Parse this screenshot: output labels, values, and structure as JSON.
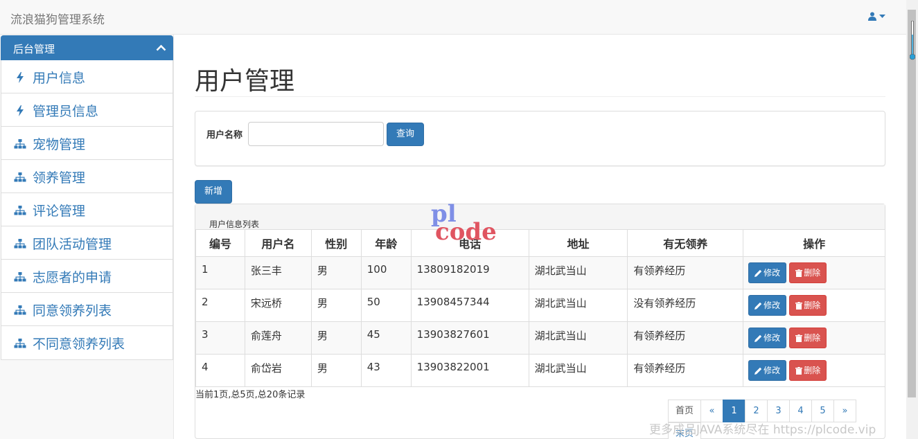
{
  "app": {
    "title": "流浪猫狗管理系统"
  },
  "sidebar": {
    "header": "后台管理",
    "items": [
      {
        "label": "用户信息",
        "icon": "bolt-icon"
      },
      {
        "label": "管理员信息",
        "icon": "bolt-icon"
      },
      {
        "label": "宠物管理",
        "icon": "sitemap-icon"
      },
      {
        "label": "领养管理",
        "icon": "sitemap-icon"
      },
      {
        "label": "评论管理",
        "icon": "sitemap-icon"
      },
      {
        "label": "团队活动管理",
        "icon": "sitemap-icon"
      },
      {
        "label": "志愿者的申请",
        "icon": "sitemap-icon"
      },
      {
        "label": "同意领养列表",
        "icon": "sitemap-icon"
      },
      {
        "label": "不同意领养列表",
        "icon": "sitemap-icon"
      }
    ]
  },
  "main": {
    "page_title": "用户管理",
    "search": {
      "label": "用户名称",
      "value": "",
      "button": "查询"
    },
    "add_button": "新增",
    "table": {
      "caption": "用户信息列表",
      "columns": [
        "编号",
        "用户名",
        "性别",
        "年龄",
        "电话",
        "地址",
        "有无领养",
        "操作"
      ],
      "rows": [
        [
          "1",
          "张三丰",
          "男",
          "100",
          "13809182019",
          "湖北武当山",
          "有领养经历"
        ],
        [
          "2",
          "宋远桥",
          "男",
          "50",
          "13908457344",
          "湖北武当山",
          "没有领养经历"
        ],
        [
          "3",
          "俞莲舟",
          "男",
          "45",
          "13903827601",
          "湖北武当山",
          "有领养经历"
        ],
        [
          "4",
          "俞岱岩",
          "男",
          "43",
          "13903822001",
          "湖北武当山",
          "有领养经历"
        ]
      ],
      "edit_label": "修改",
      "delete_label": "删除"
    },
    "summary": "当前1页,总5页,总20条记录",
    "pagination": {
      "first": "首页",
      "prev": "«",
      "pages": [
        "1",
        "2",
        "3",
        "4",
        "5"
      ],
      "next": "»",
      "last": "末页",
      "current": "1"
    }
  },
  "watermark": {
    "logo_top": "pl",
    "logo_bottom": "code",
    "text": "更多成品JAVA系统尽在 https://plcode.vip"
  },
  "colors": {
    "primary": "#337ab7",
    "danger": "#d9534f"
  }
}
